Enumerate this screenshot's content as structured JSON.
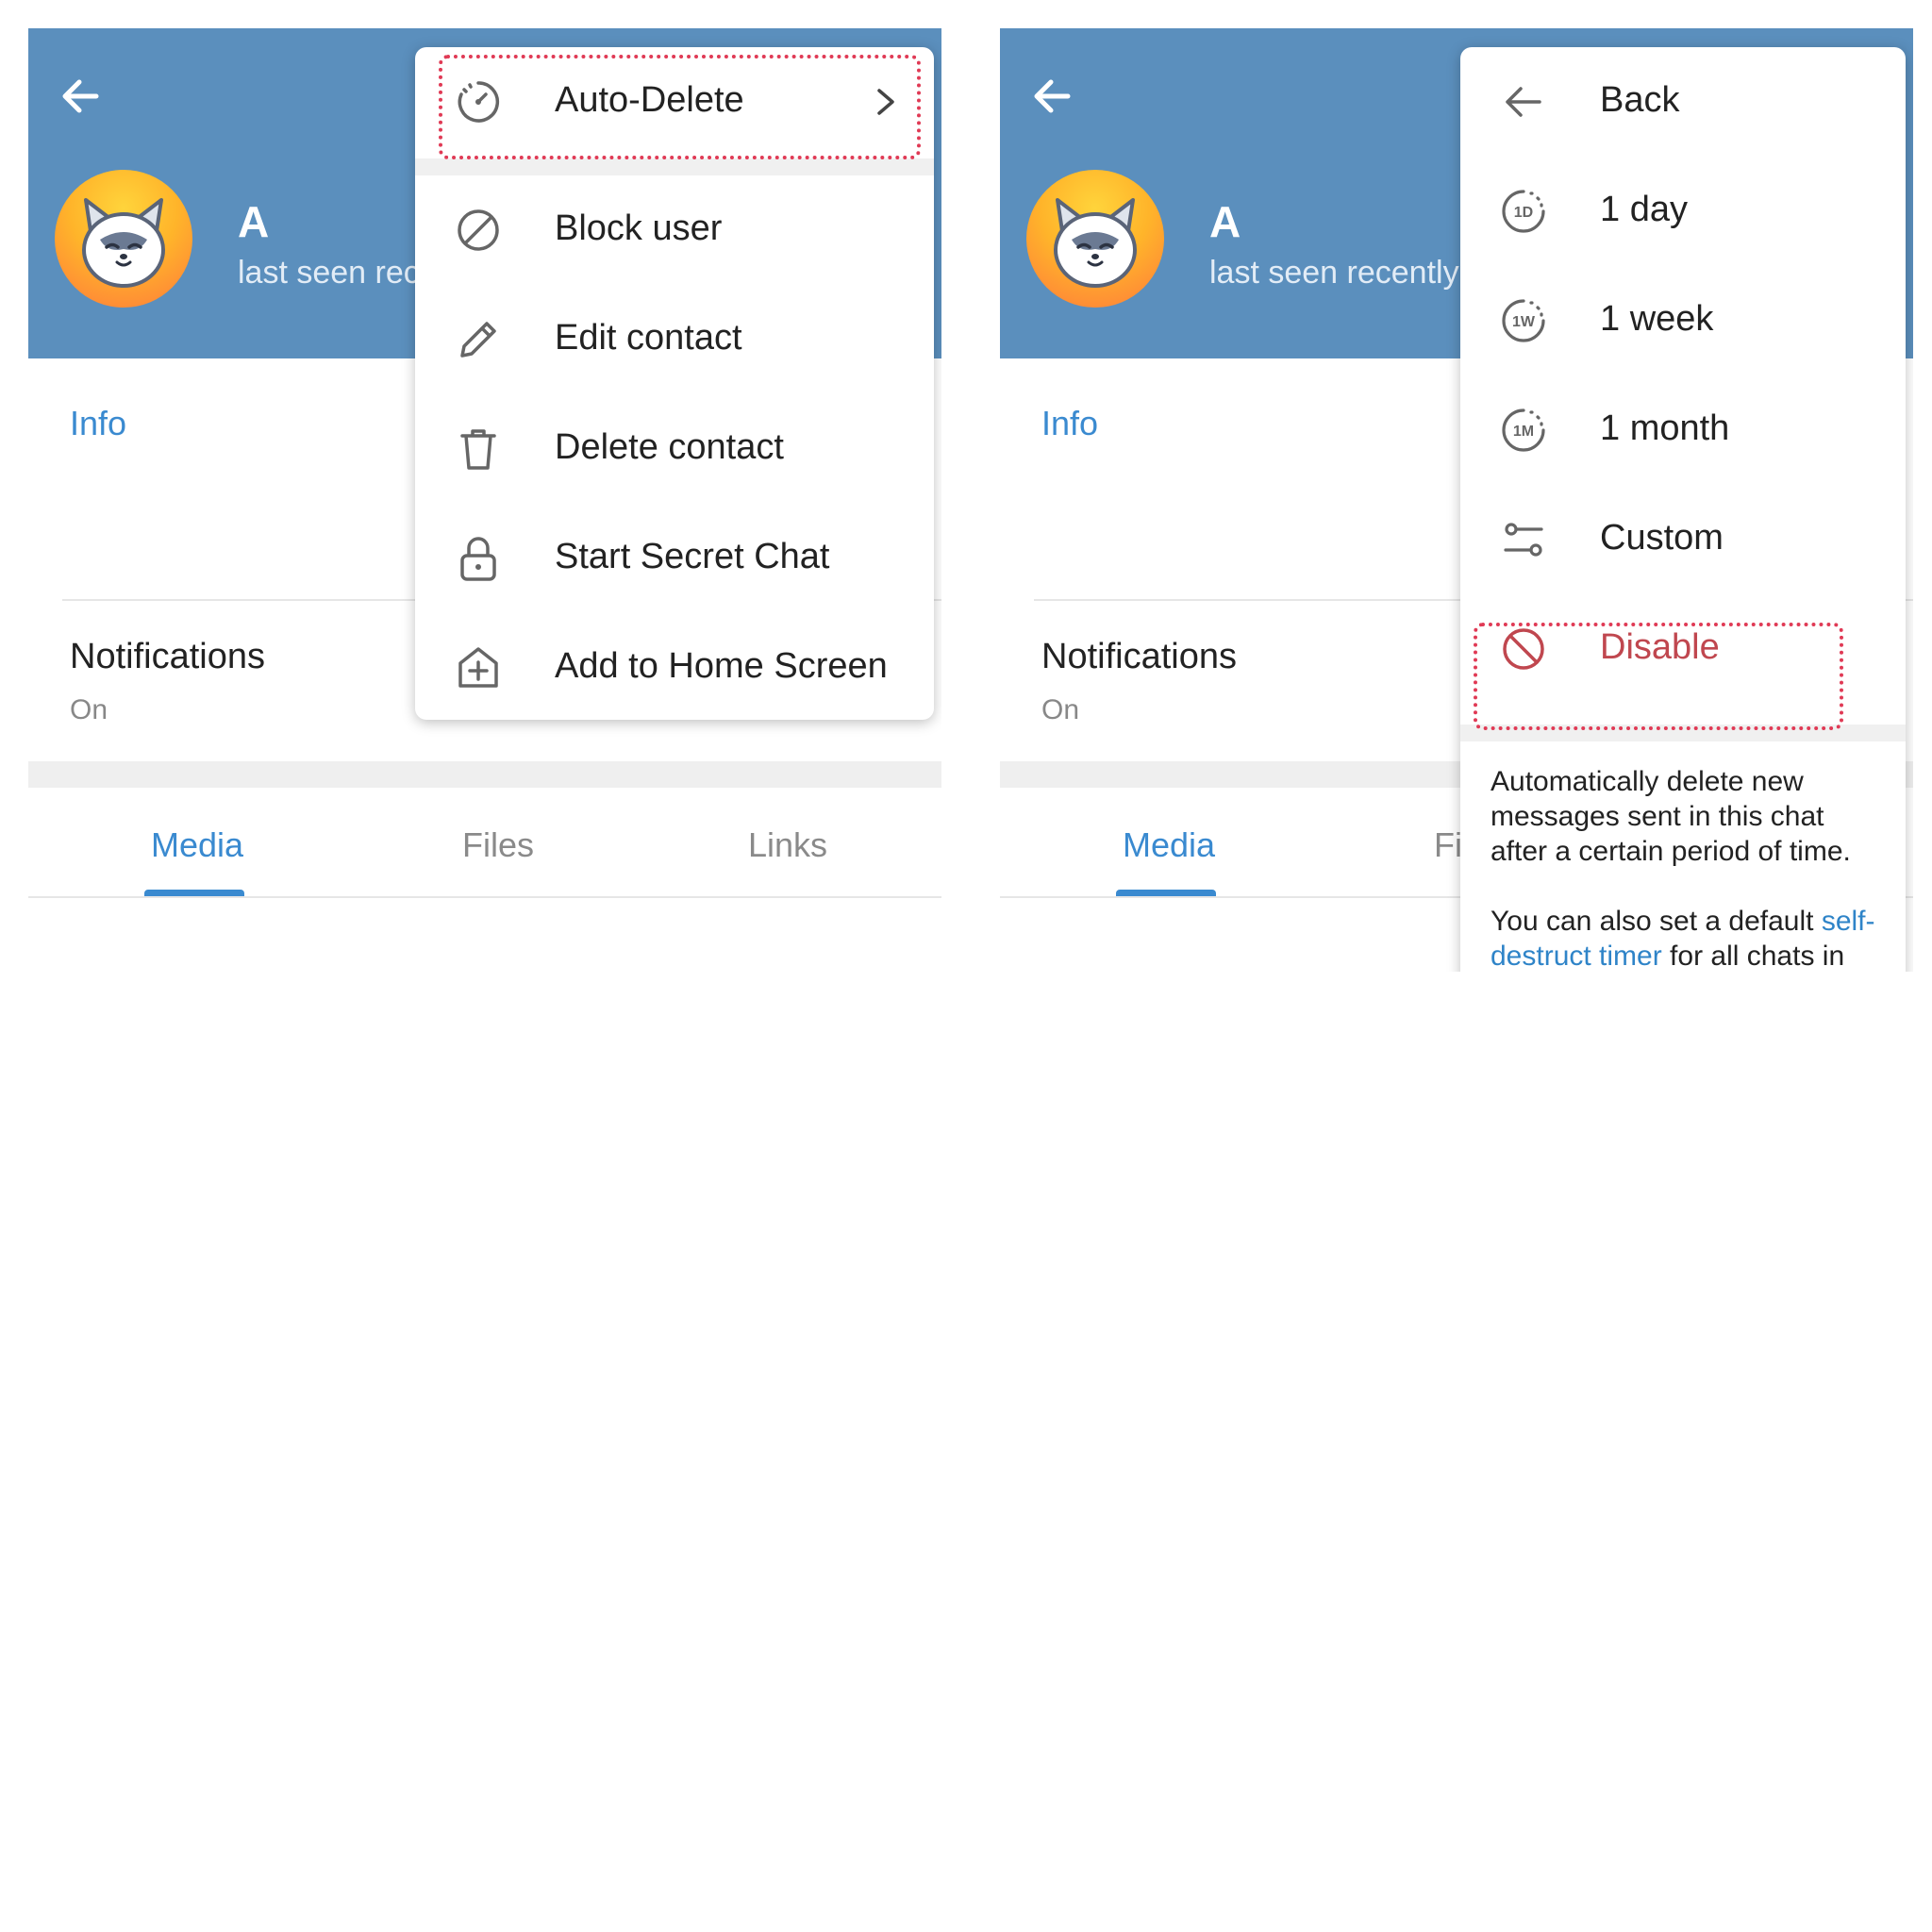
{
  "left_screen": {
    "profile": {
      "name": "A",
      "status": "last seen rec"
    },
    "info_label": "Info",
    "notifications": {
      "title": "Notifications",
      "value": "On"
    },
    "tabs": [
      "Media",
      "Files",
      "Links"
    ],
    "menu": {
      "items": [
        {
          "label": "Auto-Delete",
          "icon": "timer-icon"
        },
        {
          "label": "Block user",
          "icon": "block-icon"
        },
        {
          "label": "Edit contact",
          "icon": "pencil-icon"
        },
        {
          "label": "Delete contact",
          "icon": "trash-icon"
        },
        {
          "label": "Start Secret Chat",
          "icon": "lock-icon"
        },
        {
          "label": "Add to Home Screen",
          "icon": "add-home-icon"
        }
      ]
    }
  },
  "right_screen": {
    "profile": {
      "name": "A",
      "status": "last seen recently"
    },
    "info_label": "Info",
    "notifications": {
      "title": "Notifications",
      "value": "On"
    },
    "tabs": [
      "Media",
      "Fi"
    ],
    "menu": {
      "items": [
        {
          "label": "Back",
          "icon": "arrow-left-icon"
        },
        {
          "label": "1 day",
          "icon": "1d-timer-icon",
          "badge": "1D"
        },
        {
          "label": "1 week",
          "icon": "1w-timer-icon",
          "badge": "1W"
        },
        {
          "label": "1 month",
          "icon": "1m-timer-icon",
          "badge": "1M"
        },
        {
          "label": "Custom",
          "icon": "sliders-icon"
        },
        {
          "label": "Disable",
          "icon": "prohibit-icon"
        }
      ],
      "help_text_1": "Automatically delete new messages sent in this chat after a certain period of time.",
      "help_text_2_pre": "You can also set a default ",
      "help_text_2_link": "self-destruct timer",
      "help_text_2_post": " for all chats in Settings."
    }
  },
  "colors": {
    "header": "#5b8fbd",
    "accent": "#3a8ad0",
    "destructive": "#c0474f",
    "highlight": "#e03a55"
  }
}
